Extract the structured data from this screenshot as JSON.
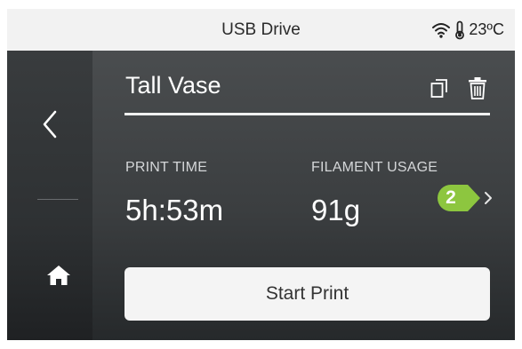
{
  "status_bar": {
    "title": "USB Drive",
    "temperature": "23ºC",
    "wifi_icon": "wifi-icon",
    "thermometer_icon": "thermometer-icon"
  },
  "sidebar": {
    "back_icon": "chevron-left-icon",
    "home_icon": "home-icon"
  },
  "file": {
    "name": "Tall Vase",
    "copy_icon": "copy-icon",
    "delete_icon": "trash-icon"
  },
  "stats": {
    "print_time_label": "PRINT TIME",
    "print_time_value": "5h:53m",
    "filament_label": "FILAMENT USAGE",
    "filament_value": "91g",
    "detail_icon": "chevron-right-icon"
  },
  "annotation": {
    "step_number": "2",
    "color": "#8dc63f"
  },
  "actions": {
    "start_print_label": "Start Print"
  }
}
